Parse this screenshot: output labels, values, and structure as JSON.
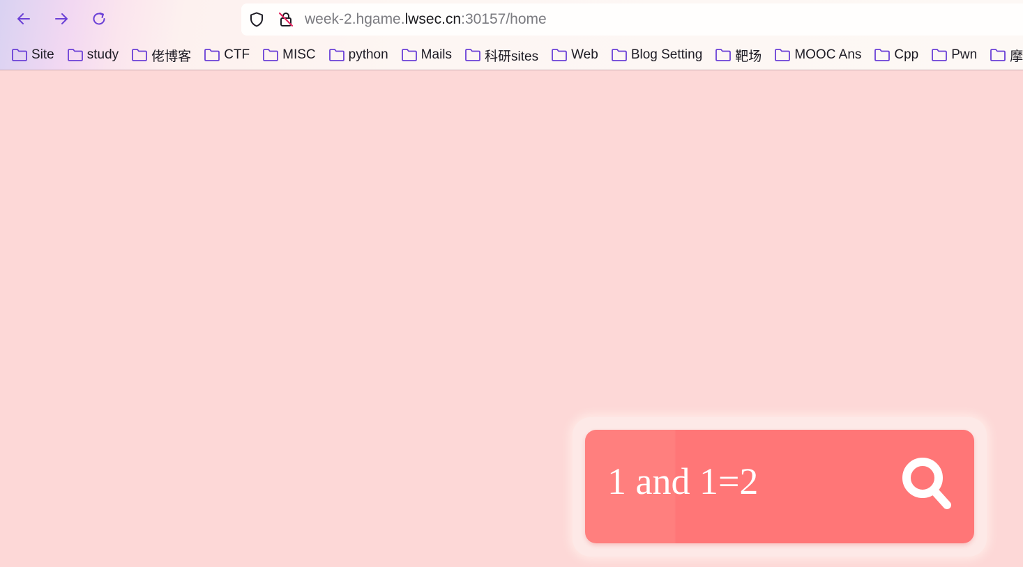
{
  "browser": {
    "url": {
      "prefix": "week-2.hgame.",
      "domain": "lwsec.cn",
      "suffix": ":30157/home"
    },
    "bookmarks": [
      {
        "label": "Site"
      },
      {
        "label": "study"
      },
      {
        "label": "佬博客"
      },
      {
        "label": "CTF"
      },
      {
        "label": "MISC"
      },
      {
        "label": "python"
      },
      {
        "label": "Mails"
      },
      {
        "label": "科研sites"
      },
      {
        "label": "Web"
      },
      {
        "label": "Blog Setting"
      },
      {
        "label": "靶场"
      },
      {
        "label": "MOOC Ans"
      },
      {
        "label": "Cpp"
      },
      {
        "label": "Pwn"
      },
      {
        "label": "摩"
      }
    ],
    "icons": {
      "back": "arrow-left-icon",
      "forward": "arrow-right-icon",
      "reload": "reload-icon",
      "shield": "shield-icon",
      "insecure": "insecure-lock-icon",
      "folder": "folder-icon"
    },
    "accent_color": "#6a3fd6"
  },
  "page": {
    "background_color": "#fdd8d7",
    "search": {
      "value": "1 and 1=2",
      "placeholder": "",
      "box_color": "#ff7677",
      "button_icon": "search-icon"
    }
  }
}
